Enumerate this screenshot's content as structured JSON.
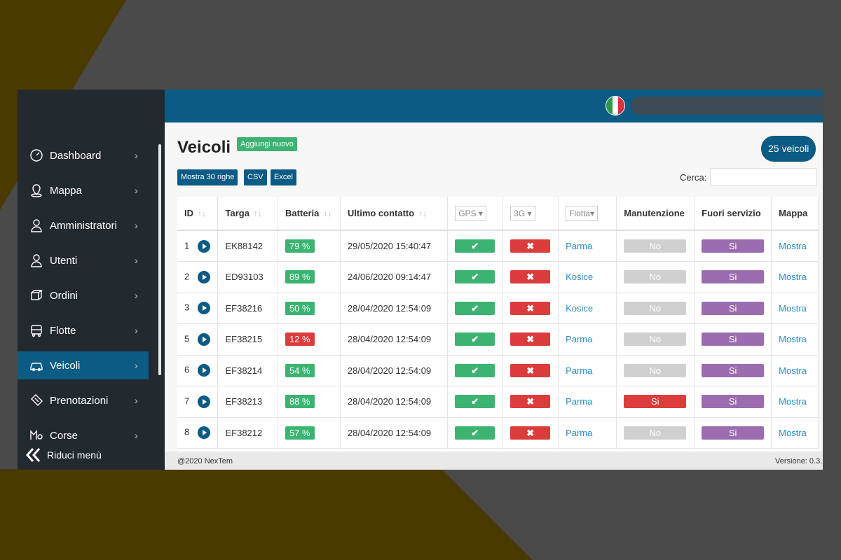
{
  "colors": {
    "primary": "#0b5b85",
    "success": "#3cb371",
    "danger": "#dc3c3c",
    "purple": "#9b6cb0",
    "muted": "#d0d0d0"
  },
  "sidebar": {
    "items": [
      {
        "label": "Dashboard",
        "icon": "gauge-icon"
      },
      {
        "label": "Mappa",
        "icon": "map-pin-icon"
      },
      {
        "label": "Amministratori",
        "icon": "admin-user-icon"
      },
      {
        "label": "Utenti",
        "icon": "user-icon"
      },
      {
        "label": "Ordini",
        "icon": "boxes-icon"
      },
      {
        "label": "Flotte",
        "icon": "vehicle-icon"
      },
      {
        "label": "Veicoli",
        "icon": "car-icon",
        "active": true
      },
      {
        "label": "Prenotazioni",
        "icon": "ticket-icon"
      },
      {
        "label": "Corse",
        "icon": "route-icon"
      }
    ],
    "collapse_label": "Riduci menù"
  },
  "page": {
    "title": "Veicoli",
    "add_label": "Aggiungi nuovo",
    "count_label": "25 veicoli",
    "tools": [
      "Mostra 30 righe",
      "CSV",
      "Excel"
    ],
    "search_label": "Cerca:"
  },
  "table": {
    "columns": [
      "ID",
      "Targa",
      "Batteria",
      "Ultimo contatto",
      "GPS",
      "3G",
      "Flotta",
      "Manutenzione",
      "Fuori servizio",
      "Mappa"
    ],
    "rows": [
      {
        "id": "1",
        "targa": "EK88142",
        "batt": "79 %",
        "battStatus": "ok",
        "contact": "29/05/2020 15:40:47",
        "gps": true,
        "g3": false,
        "flotta": "Parma",
        "manut": "No",
        "fuori": "Si",
        "mappa": "Mostra"
      },
      {
        "id": "2",
        "targa": "ED93103",
        "batt": "89 %",
        "battStatus": "ok",
        "contact": "24/06/2020 09:14:47",
        "gps": true,
        "g3": false,
        "flotta": "Kosice",
        "manut": "No",
        "fuori": "Si",
        "mappa": "Mostra"
      },
      {
        "id": "3",
        "targa": "EF38216",
        "batt": "50 %",
        "battStatus": "ok",
        "contact": "28/04/2020 12:54:09",
        "gps": true,
        "g3": false,
        "flotta": "Kosice",
        "manut": "No",
        "fuori": "Si",
        "mappa": "Mostra"
      },
      {
        "id": "5",
        "targa": "EF38215",
        "batt": "12 %",
        "battStatus": "low",
        "contact": "28/04/2020 12:54:09",
        "gps": true,
        "g3": false,
        "flotta": "Parma",
        "manut": "No",
        "fuori": "Si",
        "mappa": "Mostra"
      },
      {
        "id": "6",
        "targa": "EF38214",
        "batt": "54 %",
        "battStatus": "ok",
        "contact": "28/04/2020 12:54:09",
        "gps": true,
        "g3": false,
        "flotta": "Parma",
        "manut": "No",
        "fuori": "Si",
        "mappa": "Mostra"
      },
      {
        "id": "7",
        "targa": "EF38213",
        "batt": "88 %",
        "battStatus": "ok",
        "contact": "28/04/2020 12:54:09",
        "gps": true,
        "g3": false,
        "flotta": "Parma",
        "manut": "Si",
        "fuori": "Si",
        "mappa": "Mostra"
      },
      {
        "id": "8",
        "targa": "EF38212",
        "batt": "57 %",
        "battStatus": "ok",
        "contact": "28/04/2020 12:54:09",
        "gps": true,
        "g3": false,
        "flotta": "Parma",
        "manut": "No",
        "fuori": "Si",
        "mappa": "Mostra"
      }
    ]
  },
  "footer": {
    "copyright": "@2020 NexTem",
    "version": "Versione: 0.3."
  }
}
